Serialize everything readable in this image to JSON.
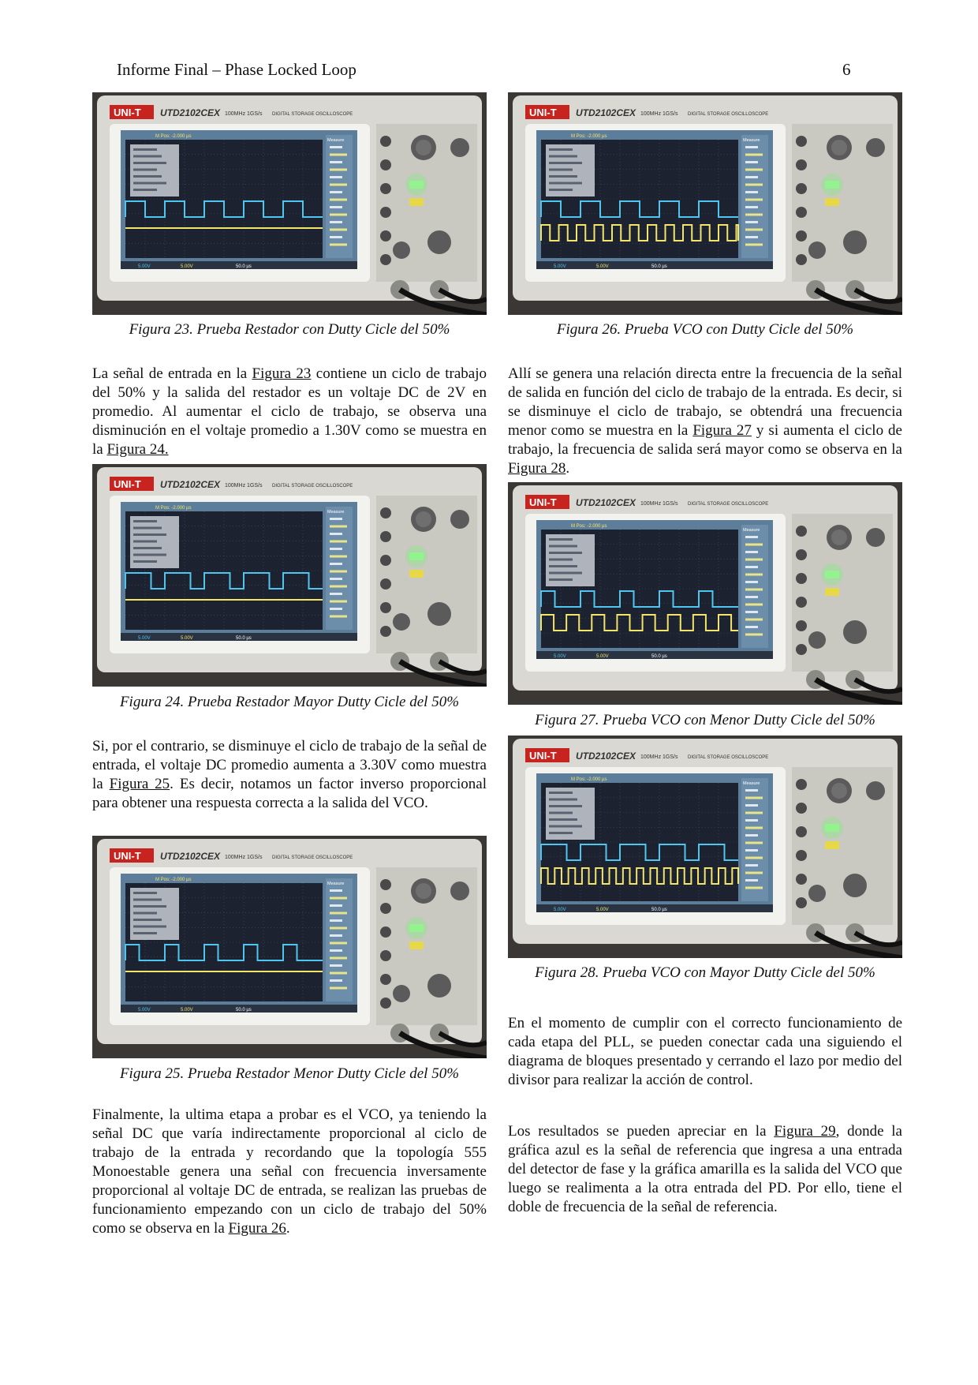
{
  "header": {
    "title": "Informe Final – Phase Locked Loop",
    "page_number": "6"
  },
  "scope": {
    "brand": "UNI-T",
    "model": "UTD2102CEX",
    "spec": "100MHz 1GS/s",
    "desc": "DIGITAL STORAGE OSCILLOSCOPE",
    "trig_label": "M Pos: -2.000 µs",
    "measure_label": "Measure",
    "ch1_scale": "5.00V",
    "ch2_scale": "5.00V",
    "time_scale": "50.0 µs"
  },
  "figures": {
    "fig23": {
      "caption": "Figura 23. Prueba Restador con Dutty Cicle del 50%"
    },
    "fig24": {
      "caption": "Figura 24. Prueba Restador Mayor Dutty Cicle del 50%"
    },
    "fig25": {
      "caption": "Figura 25. Prueba Restador Menor Dutty Cicle del 50%"
    },
    "fig26": {
      "caption": "Figura 26. Prueba VCO con Dutty Cicle del 50%"
    },
    "fig27": {
      "caption": "Figura 27. Prueba VCO con Menor Dutty Cicle del 50%"
    },
    "fig28": {
      "caption": "Figura 28. Prueba VCO con Mayor Dutty Cicle del 50%"
    }
  },
  "paragraphs": {
    "p1": {
      "a": "La señal de entrada en la ",
      "ref1": "Figura 23",
      "b": " contiene un ciclo de trabajo del 50% y la salida del restador es un voltaje DC de 2V en promedio. Al aumentar el ciclo de trabajo, se observa una disminución en el voltaje promedio a 1.30V como se muestra en la ",
      "ref2": "Figura 24."
    },
    "p2": {
      "a": "Si, por el contrario, se disminuye el ciclo de trabajo de la señal de entrada, el voltaje DC promedio aumenta a 3.30V como muestra la ",
      "ref1": "Figura 25",
      "b": ". Es decir, notamos un factor inverso proporcional para obtener una respuesta correcta a la salida del VCO."
    },
    "p3": {
      "a": "Finalmente, la ultima etapa a probar es el VCO, ya teniendo la señal DC que varía indirectamente proporcional al ciclo de trabajo de la entrada y recordando que la topología 555 Monoestable genera una señal con frecuencia inversamente proporcional al voltaje DC de entrada, se realizan las pruebas de funcionamiento empezando con un ciclo de trabajo del 50% como se observa en la ",
      "ref1": "Figura 26",
      "b": "."
    },
    "p4": {
      "a": "Allí se genera una relación directa entre la frecuencia de la señal de salida en función del ciclo de trabajo de la entrada. Es decir, si se disminuye el ciclo de trabajo, se obtendrá una frecuencia menor como se muestra en la ",
      "ref1": "Figura 27",
      "b": " y si aumenta el ciclo de trabajo, la frecuencia de salida será mayor como se observa en la ",
      "ref2": "Figura 28",
      "c": "."
    },
    "p5": {
      "a": "En el momento de cumplir con el correcto funcionamiento de cada etapa del PLL, se pueden conectar cada una siguiendo el diagrama de bloques presentado y cerrando el lazo por medio del divisor para realizar la acción de control."
    },
    "p6": {
      "a": "Los resultados se pueden apreciar en la ",
      "ref1": "Figura 29",
      "b": ", donde la gráfica azul es la señal de referencia que ingresa a una entrada del detector de fase y la gráfica amarilla es la salida del VCO que luego se realimenta a la otra entrada del PD. Por ello, tiene el doble de frecuencia de la señal de referencia."
    }
  }
}
